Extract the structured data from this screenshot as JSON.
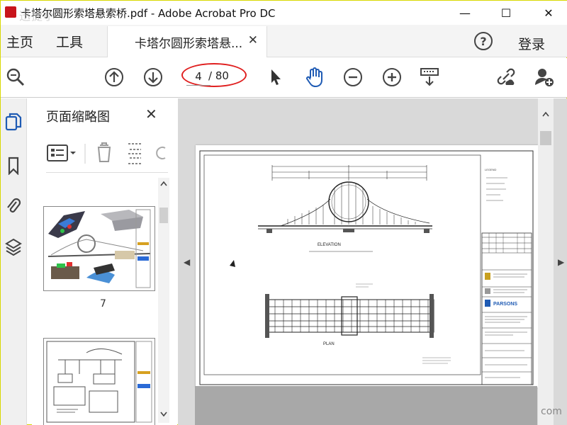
{
  "window": {
    "title": "卡塔尔圆形索塔悬索桥.pdf - Adobe Acrobat Pro DC",
    "watermark": "迅捷小",
    "minimize": "—",
    "maximize": "☐",
    "close": "✕"
  },
  "menu": {
    "home": "主页",
    "tools": "工具",
    "doc_tab": "卡塔尔圆形索塔悬...",
    "doc_tab_close": "✕",
    "help": "?",
    "login": "登录"
  },
  "toolbar": {
    "current_page": "4",
    "total_pages": "/ 80"
  },
  "thumbnails": {
    "title": "页面缩略图",
    "close": "✕",
    "page_label": "7"
  },
  "drawing": {
    "elevation": "ELEVATION",
    "plan": "PLAN",
    "legend": "LEGEND",
    "company": "PARSONS"
  },
  "corner_watermark": "com",
  "colors": {
    "highlight_ellipse": "#e02020",
    "accent_blue": "#1f5bb4"
  }
}
